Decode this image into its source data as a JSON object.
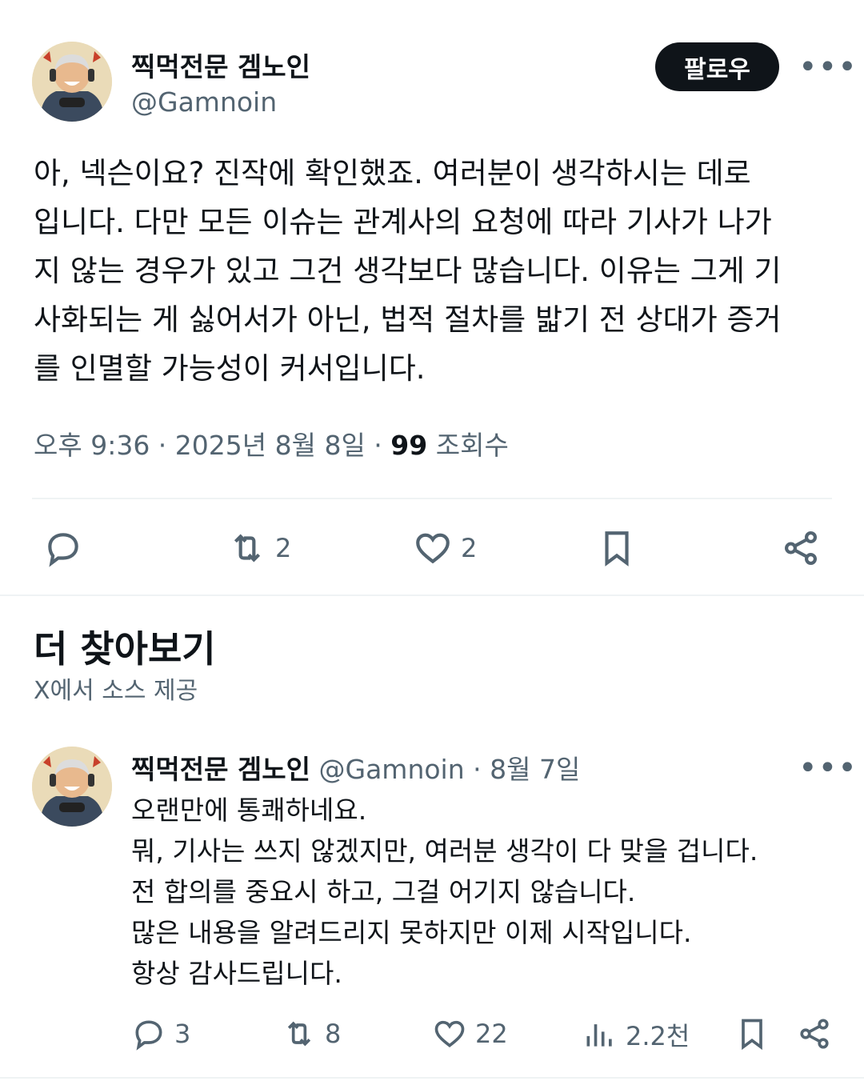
{
  "post": {
    "author_name": "찍먹전문 겜노인",
    "author_handle": "@Gamnoin",
    "follow_label": "팔로우",
    "more_label": "•••",
    "text_lines": [
      "아, 넥슨이요? 진작에 확인했죠. 여러분이 생각하시는 데로",
      "입니다. 다만 모든 이슈는 관계사의 요청에 따라 기사가 나가",
      "지 않는 경우가 있고 그건 생각보다 많습니다. 이유는 그게 기",
      "사화되는 게 싫어서가 아닌, 법적 절차를 밟기 전 상대가 증거",
      "를 인멸할 가능성이 커서입니다."
    ],
    "time": "오후 9:36 · 2025년 8월 8일 · ",
    "views_count": "99",
    "views_label": " 조회수",
    "actions": {
      "reply_icon": "reply-icon",
      "retweet_icon": "retweet-icon",
      "retweet_count": "2",
      "like_icon": "heart-icon",
      "like_count": "2",
      "bookmark_icon": "bookmark-icon",
      "share_icon": "share-icon"
    }
  },
  "discover": {
    "title": "더 찾아보기",
    "subtitle": "X에서 소스 제공"
  },
  "reply_post": {
    "author_name": "찍먹전문 겜노인",
    "author_handle": "@Gamnoin",
    "date": " · 8월 7일",
    "more_label": "•••",
    "text_lines": [
      "오랜만에 통쾌하네요.",
      "뭐, 기사는 쓰지 않겠지만, 여러분 생각이 다 맞을 겁니다.",
      "전 합의를 중요시 하고, 그걸 어기지 않습니다.",
      "많은 내용을 알려드리지 못하지만 이제 시작입니다.",
      "항상 감사드립니다."
    ],
    "actions": {
      "reply_count": "3",
      "retweet_count": "8",
      "like_count": "22",
      "views_count": "2.2천"
    }
  },
  "colors": {
    "text_primary": "#0f1419",
    "text_secondary": "#536471",
    "divider": "#eff3f4",
    "follow_bg": "#0f1419"
  }
}
